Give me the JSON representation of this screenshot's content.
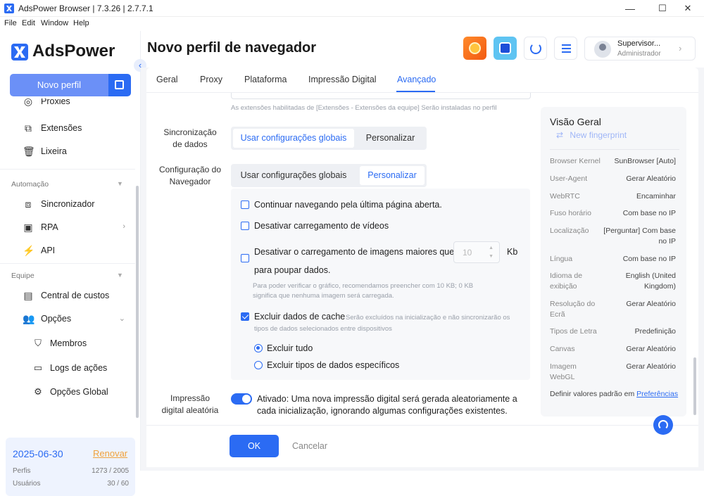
{
  "window": {
    "title": "AdsPower Browser | 7.3.26 | 2.7.7.1",
    "minimize": "—",
    "maximize": "☐",
    "close": "✕"
  },
  "menu": [
    "File",
    "Edit",
    "Window",
    "Help"
  ],
  "sidebar": {
    "logo": "AdsPower",
    "new_profile": "Novo perfil",
    "partial_item": "Proxies",
    "items": [
      {
        "label": "Extensões",
        "icon": "puzzle-icon"
      },
      {
        "label": "Lixeira",
        "icon": "trash-icon"
      }
    ],
    "automation_section": "Automação",
    "automation_items": [
      {
        "label": "Sincronizador",
        "icon": "sync-icon"
      },
      {
        "label": "RPA",
        "icon": "robot-icon"
      },
      {
        "label": "API",
        "icon": "plug-icon"
      }
    ],
    "team_section": "Equipe",
    "team_items": [
      {
        "label": "Central de custos",
        "icon": "wallet-icon"
      },
      {
        "label": "Opções",
        "icon": "users-icon"
      }
    ],
    "options_sub": [
      {
        "label": "Membros",
        "icon": "shield-icon"
      },
      {
        "label": "Logs de ações",
        "icon": "log-icon"
      },
      {
        "label": "Opções Global",
        "icon": "settings-icon"
      }
    ],
    "plan": {
      "date": "2025-06-30",
      "renew": "Renovar",
      "profiles_label": "Perfis",
      "profiles_value": "1273 / 2005",
      "users_label": "Usuários",
      "users_value": "30 / 60"
    }
  },
  "header": {
    "title": "Novo perfil de navegador",
    "user_name": "Supervisor...",
    "user_role": "Administrador"
  },
  "tabs": [
    "Geral",
    "Proxy",
    "Plataforma",
    "Impressão Digital",
    "Avançado"
  ],
  "active_tab": "Avançado",
  "form": {
    "extensions_hint": "As extensões habilitadas de [Extensões - Extensões da equipe] Serão instaladas no perfil",
    "sync_label": "Sincronização de dados",
    "sync_options": [
      "Usar configurações globais",
      "Personalizar"
    ],
    "sync_selected": "Usar configurações globais",
    "browser_label": "Configuração do Navegador",
    "browser_options": [
      "Usar configurações globais",
      "Personalizar"
    ],
    "browser_selected": "Personalizar",
    "continue_browsing": "Continuar navegando pela última página aberta.",
    "disable_videos": "Desativar carregamento de vídeos",
    "disable_images_1": "Desativar o carregamento de imagens maiores que",
    "disable_images_2": "para poupar dados.",
    "image_size_value": "10",
    "image_size_unit": "Kb",
    "image_hint": "Para poder verificar o gráfico, recomendamos preencher com 10 KB; 0 KB significa que nenhuma imagem será carregada.",
    "exclude_cache": "Excluir dados de cache",
    "exclude_cache_hint": "Serão excluídos na inicialização e não sincronizarão os tipos de dados selecionados entre dispositivos",
    "exclude_all": "Excluir tudo",
    "exclude_specific": "Excluir tipos de dados específicos",
    "random_fp_label": "Impressão digital aleatória",
    "random_fp_text": "Ativado: Uma nova impressão digital será gerada aleatoriamente a cada inicialização, ignorando algumas configurações existentes.",
    "ok": "OK",
    "cancel": "Cancelar"
  },
  "overview": {
    "title": "Visão Geral",
    "new_fingerprint": "New fingerprint",
    "rows": [
      {
        "k": "Browser Kernel",
        "v": "SunBrowser [Auto]"
      },
      {
        "k": "User-Agent",
        "v": "Gerar Aleatório"
      },
      {
        "k": "WebRTC",
        "v": "Encaminhar"
      },
      {
        "k": "Fuso horário",
        "v": "Com base no IP"
      },
      {
        "k": "Localização",
        "v": "[Perguntar] Com base no IP"
      },
      {
        "k": "Língua",
        "v": "Com base no IP"
      },
      {
        "k": "Idioma de exibição",
        "v": "English (United Kingdom)"
      },
      {
        "k": "Resolução do Ecrã",
        "v": "Gerar Aleatório"
      },
      {
        "k": "Tipos de Letra",
        "v": "Predefinição"
      },
      {
        "k": "Canvas",
        "v": "Gerar Aleatório"
      },
      {
        "k": "Imagem WebGL",
        "v": "Gerar Aleatório"
      }
    ],
    "defaults_text": "Definir valores padrão em",
    "defaults_link": "Preferências"
  }
}
